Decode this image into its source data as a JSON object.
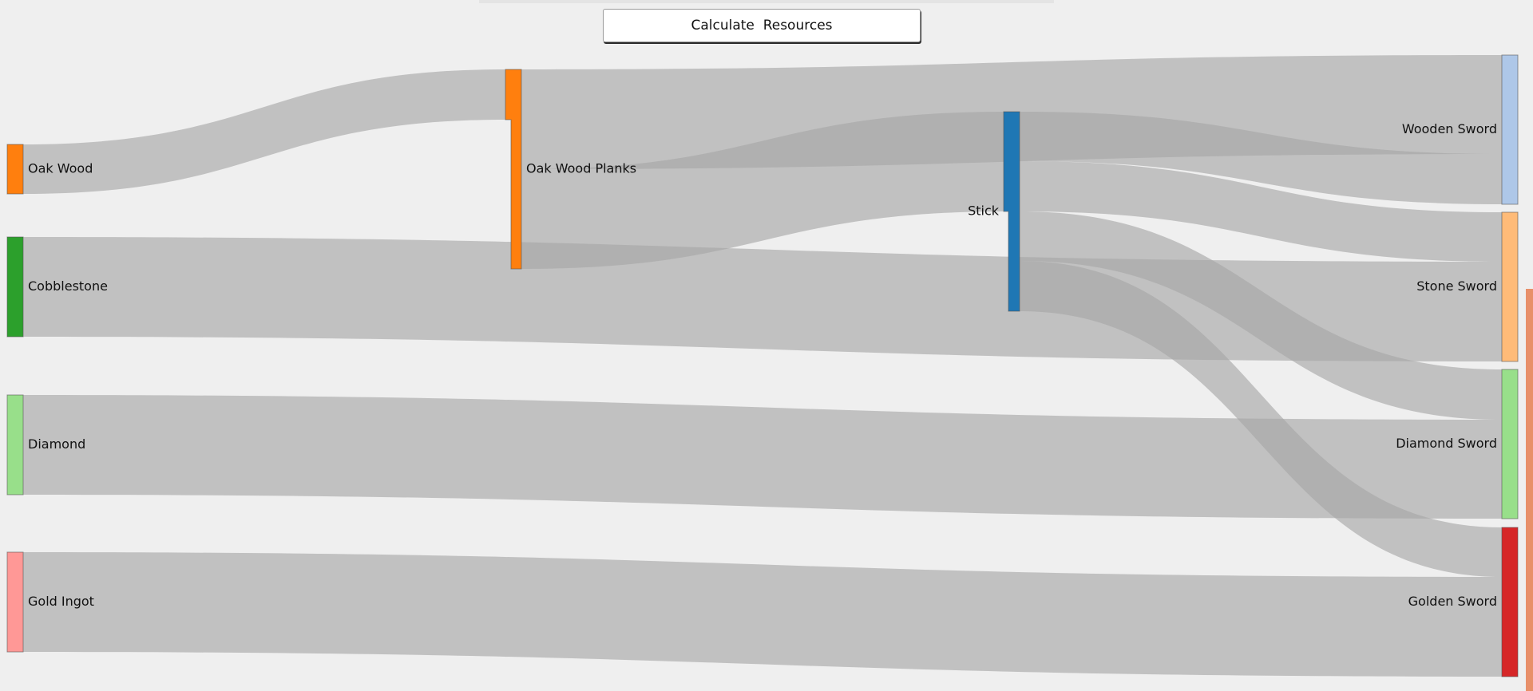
{
  "toolbar": {
    "calculate_label": "Calculate  Resources"
  },
  "diagram": {
    "type": "sankey",
    "nodes": [
      {
        "id": "oak_wood",
        "label": "Oak Wood",
        "color": "#ff7f0e"
      },
      {
        "id": "cobblestone",
        "label": "Cobblestone",
        "color": "#2ca02c"
      },
      {
        "id": "diamond",
        "label": "Diamond",
        "color": "#98df8a"
      },
      {
        "id": "gold_ingot",
        "label": "Gold Ingot",
        "color": "#ff9896"
      },
      {
        "id": "oak_wood_planks",
        "label": "Oak Wood Planks",
        "color": "#ff7f0e"
      },
      {
        "id": "stick",
        "label": "Stick",
        "color": "#1f77b4"
      },
      {
        "id": "wooden_sword",
        "label": "Wooden Sword",
        "color": "#aec7e8"
      },
      {
        "id": "stone_sword",
        "label": "Stone Sword",
        "color": "#ffbb78"
      },
      {
        "id": "diamond_sword",
        "label": "Diamond Sword",
        "color": "#98df8a"
      },
      {
        "id": "golden_sword",
        "label": "Golden Sword",
        "color": "#d62728"
      }
    ],
    "links": [
      {
        "source": "oak_wood",
        "target": "oak_wood_planks",
        "value": 1
      },
      {
        "source": "oak_wood_planks",
        "target": "wooden_sword",
        "value": 2
      },
      {
        "source": "oak_wood_planks",
        "target": "stick",
        "value": 2
      },
      {
        "source": "cobblestone",
        "target": "stone_sword",
        "value": 2
      },
      {
        "source": "diamond",
        "target": "diamond_sword",
        "value": 2
      },
      {
        "source": "gold_ingot",
        "target": "golden_sword",
        "value": 2
      },
      {
        "source": "stick",
        "target": "wooden_sword",
        "value": 1
      },
      {
        "source": "stick",
        "target": "stone_sword",
        "value": 1
      },
      {
        "source": "stick",
        "target": "diamond_sword",
        "value": 1
      },
      {
        "source": "stick",
        "target": "golden_sword",
        "value": 1
      }
    ],
    "link_color": "#a8a8a8",
    "link_opacity": 0.65
  }
}
